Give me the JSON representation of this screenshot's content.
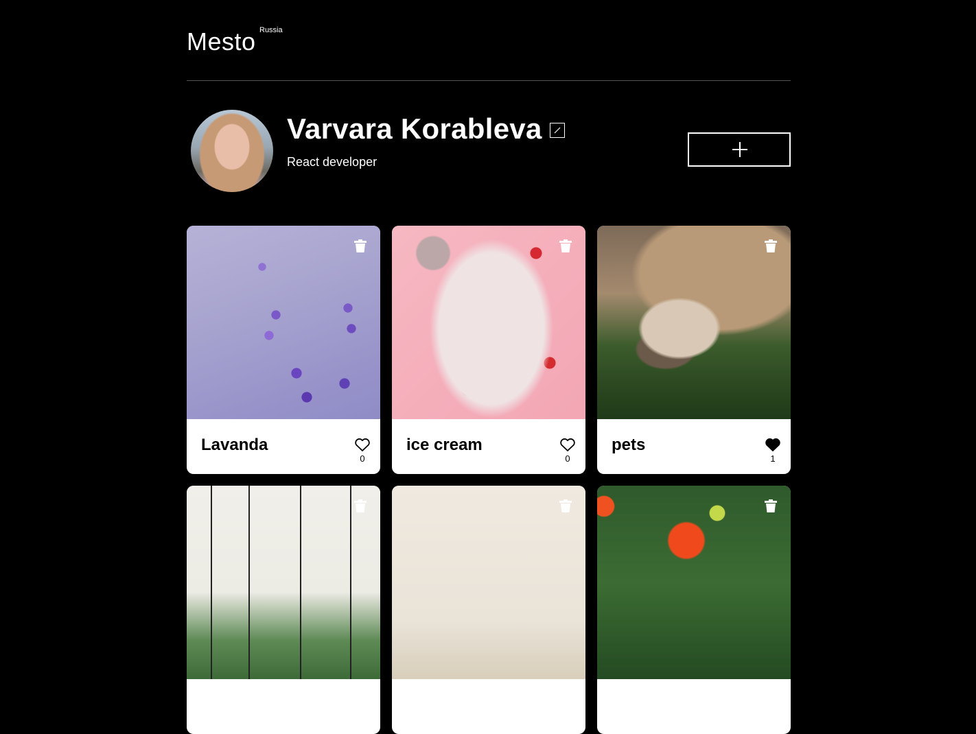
{
  "header": {
    "logo": "Mesto",
    "logo_superscript": "Russia"
  },
  "profile": {
    "name": "Varvara Korableva",
    "about": "React developer",
    "edit_icon": "pencil-icon",
    "add_icon": "plus-icon"
  },
  "cards": [
    {
      "title": "Lavanda",
      "likes": "0",
      "liked": false
    },
    {
      "title": "ice cream",
      "likes": "0",
      "liked": false
    },
    {
      "title": "pets",
      "likes": "1",
      "liked": true
    },
    {
      "title": "",
      "likes": "",
      "liked": false
    },
    {
      "title": "",
      "likes": "",
      "liked": false
    },
    {
      "title": "",
      "likes": "",
      "liked": false
    }
  ],
  "colors": {
    "background": "#000000",
    "card": "#ffffff",
    "text": "#ffffff",
    "divider": "#545454"
  }
}
